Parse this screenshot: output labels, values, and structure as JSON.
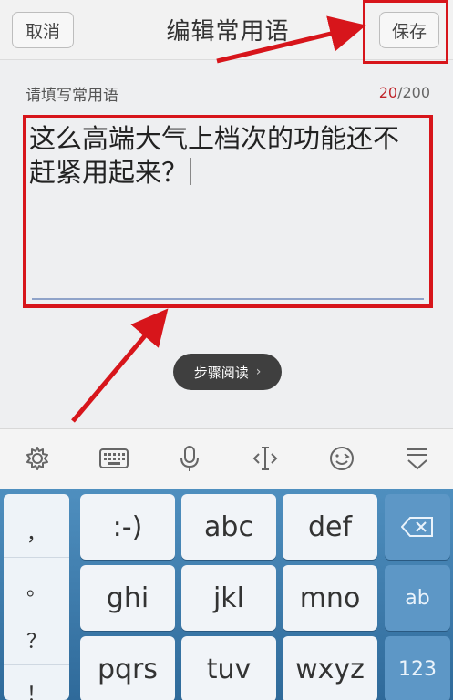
{
  "header": {
    "cancel_label": "取消",
    "title": "编辑常用语",
    "save_label": "保存"
  },
  "form": {
    "label": "请填写常用语",
    "count_current": "20",
    "count_max": "/200",
    "text": "这么高端大气上档次的功能还不赶紧用起来？"
  },
  "toast": {
    "label": "步骤阅读"
  },
  "toolbar": {
    "icons": [
      "gear-icon",
      "keyboard-icon",
      "microphone-icon",
      "text-cursor-icon",
      "emoji-icon",
      "collapse-keyboard-icon"
    ]
  },
  "keyboard": {
    "punctuation": [
      "，",
      "。",
      "？",
      "！"
    ],
    "row1": [
      ":-)",
      "abc",
      "def"
    ],
    "row2": [
      "ghi",
      "jkl",
      "mno"
    ],
    "row3": [
      "pqrs",
      "tuv",
      "wxyz"
    ],
    "backspace_icon": "backspace-icon",
    "switch_label": "ab",
    "numbers_label": "123"
  },
  "colors": {
    "annotation_red": "#d7151b",
    "keyboard_blue": "#3a79a9",
    "counter_red": "#c0262c"
  }
}
